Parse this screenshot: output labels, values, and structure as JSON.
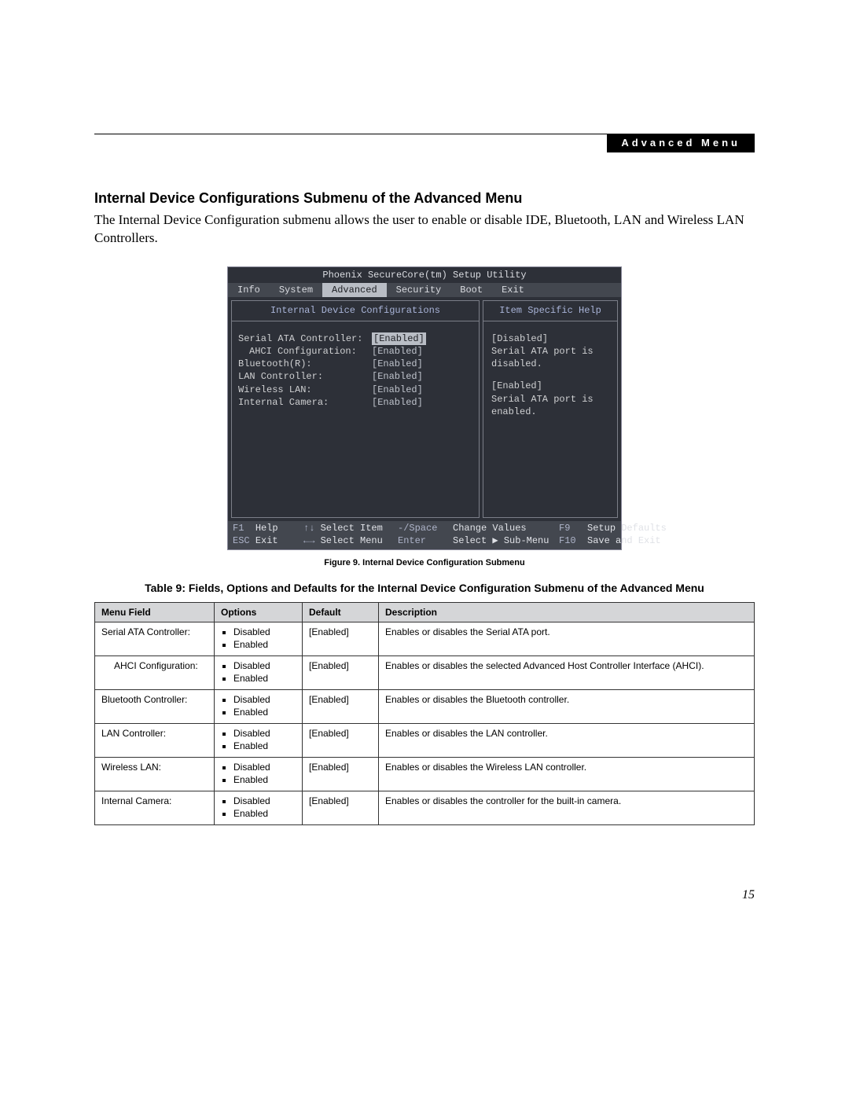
{
  "header": {
    "badge": "Advanced Menu"
  },
  "section": {
    "title": "Internal Device Configurations Submenu of the Advanced Menu",
    "intro": "The Internal Device Configuration submenu allows the user to enable or disable IDE, Bluetooth, LAN and Wireless LAN Controllers."
  },
  "bios": {
    "title": "Phoenix SecureCore(tm) Setup Utility",
    "tabs": [
      "Info",
      "System",
      "Advanced",
      "Security",
      "Boot",
      "Exit"
    ],
    "active_tab_index": 2,
    "left_panel_title": "Internal Device Configurations",
    "right_panel_title": "Item Specific Help",
    "items": [
      {
        "label": "Serial ATA Controller:",
        "value": "[Enabled]",
        "selected": true,
        "indent": false
      },
      {
        "label": "AHCI Configuration:",
        "value": "[Enabled]",
        "selected": false,
        "indent": true
      },
      {
        "label": "Bluetooth(R):",
        "value": "[Enabled]",
        "selected": false,
        "indent": false
      },
      {
        "label": "LAN Controller:",
        "value": "[Enabled]",
        "selected": false,
        "indent": false
      },
      {
        "label": "Wireless LAN:",
        "value": "[Enabled]",
        "selected": false,
        "indent": false
      },
      {
        "label": "Internal Camera:",
        "value": "[Enabled]",
        "selected": false,
        "indent": false
      }
    ],
    "help": {
      "p1a": "[Disabled]",
      "p1b": "Serial ATA port is disabled.",
      "p2a": "[Enabled]",
      "p2b": "Serial ATA port is enabled."
    },
    "footer": {
      "r1": {
        "k1": "F1",
        "a1": "Help",
        "k2": "↑↓",
        "a2": "Select Item",
        "k3": "-/Space",
        "a3": "Change Values",
        "k4": "F9",
        "a4": "Setup Defaults"
      },
      "r2": {
        "k1": "ESC",
        "a1": "Exit",
        "k2": "←→",
        "a2": "Select Menu",
        "k3": "Enter",
        "a3": "Select ▶ Sub-Menu",
        "k4": "F10",
        "a4": "Save and Exit"
      }
    }
  },
  "figure_caption": "Figure 9.  Internal Device Configuration Submenu",
  "table_caption": "Table 9: Fields, Options and Defaults for the Internal Device Configuration Submenu of the Advanced Menu",
  "table": {
    "headers": {
      "field": "Menu Field",
      "options": "Options",
      "def": "Default",
      "desc": "Description"
    },
    "rows": [
      {
        "field": "Serial ATA Controller:",
        "indent": false,
        "options": [
          "Disabled",
          "Enabled"
        ],
        "def": "[Enabled]",
        "desc": "Enables or disables the Serial ATA port."
      },
      {
        "field": "AHCI Configuration:",
        "indent": true,
        "options": [
          "Disabled",
          "Enabled"
        ],
        "def": "[Enabled]",
        "desc": "Enables or disables the selected Advanced Host Controller Interface (AHCI)."
      },
      {
        "field": "Bluetooth Controller:",
        "indent": false,
        "options": [
          "Disabled",
          "Enabled"
        ],
        "def": "[Enabled]",
        "desc": "Enables or disables the Bluetooth controller."
      },
      {
        "field": "LAN Controller:",
        "indent": false,
        "options": [
          "Disabled",
          "Enabled"
        ],
        "def": "[Enabled]",
        "desc": "Enables or disables the LAN controller."
      },
      {
        "field": "Wireless LAN:",
        "indent": false,
        "options": [
          "Disabled",
          "Enabled"
        ],
        "def": "[Enabled]",
        "desc": "Enables or disables the Wireless LAN controller."
      },
      {
        "field": "Internal Camera:",
        "indent": false,
        "options": [
          "Disabled",
          "Enabled"
        ],
        "def": "[Enabled]",
        "desc": "Enables or disables the controller for the built-in camera."
      }
    ]
  },
  "page_number": "15"
}
